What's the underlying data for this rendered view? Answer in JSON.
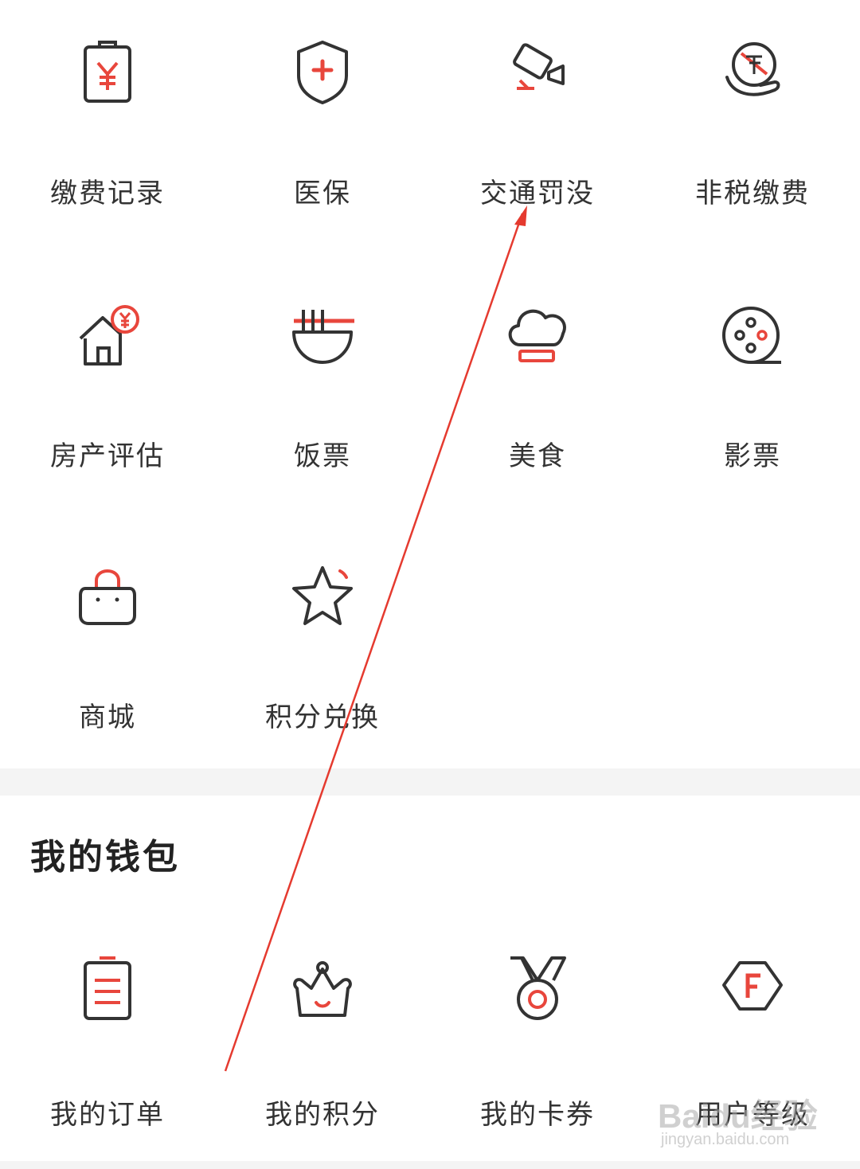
{
  "services": [
    {
      "label": "缴费记录",
      "icon": "payment-record-icon"
    },
    {
      "label": "医保",
      "icon": "medical-insurance-icon"
    },
    {
      "label": "交通罚没",
      "icon": "traffic-fine-icon"
    },
    {
      "label": "非税缴费",
      "icon": "non-tax-payment-icon"
    },
    {
      "label": "房产评估",
      "icon": "property-assessment-icon"
    },
    {
      "label": "饭票",
      "icon": "meal-ticket-icon"
    },
    {
      "label": "美食",
      "icon": "food-icon"
    },
    {
      "label": "影票",
      "icon": "movie-ticket-icon"
    },
    {
      "label": "商城",
      "icon": "mall-icon"
    },
    {
      "label": "积分兑换",
      "icon": "points-exchange-icon"
    }
  ],
  "wallet": {
    "title": "我的钱包",
    "items": [
      {
        "label": "我的订单",
        "icon": "my-orders-icon"
      },
      {
        "label": "我的积分",
        "icon": "my-points-icon"
      },
      {
        "label": "我的卡券",
        "icon": "my-coupons-icon"
      },
      {
        "label": "用户等级",
        "icon": "user-level-icon"
      }
    ]
  },
  "watermark": {
    "main": "Baidu经验",
    "sub": "jingyan.baidu.com"
  },
  "colors": {
    "accent": "#e8463c",
    "icon_stroke": "#333333",
    "divider": "#f4f4f4",
    "annotation_arrow": "#e53a2f"
  }
}
